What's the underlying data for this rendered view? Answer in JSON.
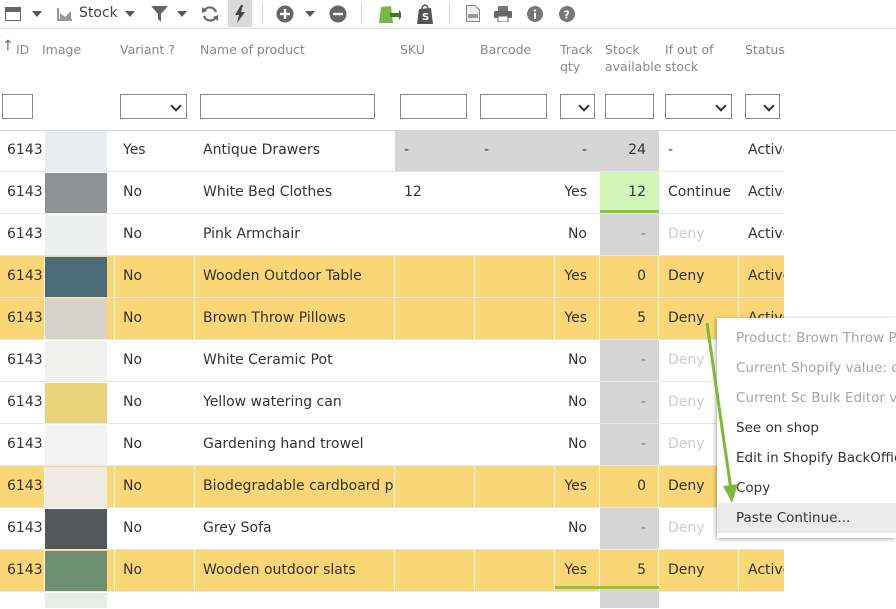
{
  "toolbar": {
    "view_label": "Stock",
    "icons": [
      "grid-menu-icon",
      "chevron-down-icon",
      "stock-icon",
      "chevron-down-icon",
      "filter-icon",
      "chevron-down-icon",
      "refresh-icon",
      "lightning-icon",
      "add-icon",
      "chevron-down-icon",
      "remove-icon",
      "shopify-sync-icon",
      "shopify-bag-icon",
      "csv-icon",
      "print-icon",
      "info-icon",
      "help-icon"
    ]
  },
  "columns": {
    "sort_arrow": "↑",
    "id": "ID",
    "image": "Image",
    "variant": "Variant ?",
    "name": "Name of product",
    "sku": "SKU",
    "barcode": "Barcode",
    "track_l1": "Track",
    "track_l2": "qty",
    "stock_l1": "Stock",
    "stock_l2": "available",
    "oos_l1": "If out of",
    "oos_l2": "stock",
    "status": "Status"
  },
  "rows": [
    {
      "id": "6143",
      "variant": "Yes",
      "name": "Antique Drawers",
      "sku": "-",
      "barcode": "-",
      "track": "-",
      "stock": "24",
      "oos": "-",
      "status": "Active",
      "thumb": "#e9ecee"
    },
    {
      "id": "6143",
      "variant": "No",
      "name": "White Bed Clothes",
      "sku": "12",
      "barcode": "",
      "track": "Yes",
      "stock": "12",
      "oos": "Continue",
      "status": "Active",
      "thumb": "#8f9295"
    },
    {
      "id": "6143",
      "variant": "No",
      "name": "Pink Armchair",
      "sku": "",
      "barcode": "",
      "track": "No",
      "stock": "-",
      "oos": "Deny",
      "status": "Active",
      "thumb": "#eef0ef"
    },
    {
      "id": "6143",
      "variant": "No",
      "name": "Wooden Outdoor Table",
      "sku": "",
      "barcode": "",
      "track": "Yes",
      "stock": "0",
      "oos": "Deny",
      "status": "Active",
      "thumb": "#4a6b7a"
    },
    {
      "id": "6143",
      "variant": "No",
      "name": "Brown Throw Pillows",
      "sku": "",
      "barcode": "",
      "track": "Yes",
      "stock": "5",
      "oos": "Deny",
      "status": "Active",
      "thumb": "#d8d2c8"
    },
    {
      "id": "6143",
      "variant": "No",
      "name": "White Ceramic Pot",
      "sku": "",
      "barcode": "",
      "track": "No",
      "stock": "-",
      "oos": "Deny",
      "status": "Active",
      "thumb": "#f1f1ef"
    },
    {
      "id": "6143",
      "variant": "No",
      "name": "Yellow watering can",
      "sku": "",
      "barcode": "",
      "track": "No",
      "stock": "-",
      "oos": "Deny",
      "status": "Active",
      "thumb": "#e8d27a"
    },
    {
      "id": "6143",
      "variant": "No",
      "name": "Gardening hand trowel",
      "sku": "",
      "barcode": "",
      "track": "No",
      "stock": "-",
      "oos": "Deny",
      "status": "Active",
      "thumb": "#f2f2f2"
    },
    {
      "id": "6143",
      "variant": "No",
      "name": "Biodegradable cardboard pots",
      "sku": "",
      "barcode": "",
      "track": "Yes",
      "stock": "0",
      "oos": "Deny",
      "status": "Active",
      "thumb": "#efeae4"
    },
    {
      "id": "6143",
      "variant": "No",
      "name": "Grey Sofa",
      "sku": "",
      "barcode": "",
      "track": "No",
      "stock": "-",
      "oos": "Deny",
      "status": "Active",
      "thumb": "#54585b"
    },
    {
      "id": "6143",
      "variant": "No",
      "name": "Wooden outdoor slats",
      "sku": "",
      "barcode": "",
      "track": "Yes",
      "stock": "5",
      "oos": "Deny",
      "status": "Active",
      "thumb": "#6f8f73"
    }
  ],
  "context_menu": {
    "items": [
      {
        "label": "Product: Brown Throw Pillows",
        "enabled": false
      },
      {
        "label": "Current Shopify value: deny",
        "enabled": false
      },
      {
        "label": "Current Sc Bulk Editor value",
        "enabled": false
      },
      {
        "label": "See on shop",
        "enabled": true
      },
      {
        "label": "Edit in Shopify BackOffice",
        "enabled": true
      },
      {
        "label": "Copy",
        "enabled": true
      },
      {
        "label": "Paste Continue...",
        "enabled": true
      }
    ]
  },
  "colors": {
    "warning_row": "#fbd676",
    "disabled_cell": "#d6d6d6",
    "stock_ok": "#d2f5b8",
    "accent_green": "#8cc63f",
    "arrow": "#7dba3a"
  }
}
